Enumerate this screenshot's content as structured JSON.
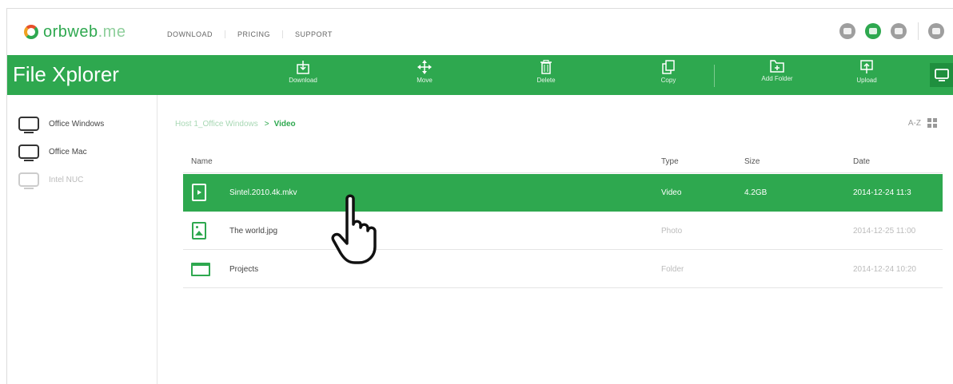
{
  "brand": {
    "name_dark": "orbweb",
    "name_light": ".me"
  },
  "nav": {
    "links": [
      "DOWNLOAD",
      "PRICING",
      "SUPPORT"
    ]
  },
  "nav_icons": [
    "chat-icon",
    "folder-icon",
    "settings-icon",
    "user-icon"
  ],
  "toolbar": {
    "title": "File Xplorer",
    "actions": [
      {
        "label": "Download",
        "icon": "download-icon"
      },
      {
        "label": "Move",
        "icon": "move-icon"
      },
      {
        "label": "Delete",
        "icon": "trash-icon"
      },
      {
        "label": "Copy",
        "icon": "copy-icon"
      },
      {
        "label": "Add Folder",
        "icon": "add-folder-icon"
      },
      {
        "label": "Upload",
        "icon": "upload-icon"
      }
    ]
  },
  "sidebar": {
    "devices": [
      {
        "name": "Office Windows",
        "active": true
      },
      {
        "name": "Office Mac",
        "active": true
      },
      {
        "name": "Intel NUC",
        "active": false
      }
    ]
  },
  "breadcrumb": {
    "host": "Host 1_Office Windows",
    "separator": ">",
    "current": "Video"
  },
  "sort": {
    "label": "A-Z"
  },
  "table": {
    "headers": {
      "name": "Name",
      "type": "Type",
      "size": "Size",
      "date": "Date"
    },
    "rows": [
      {
        "name": "Sintel.2010.4k.mkv",
        "type": "Video",
        "size": "4.2GB",
        "date": "2014-12-24 11:3",
        "selected": true,
        "icon": "video-file-icon"
      },
      {
        "name": "The world.jpg",
        "type": "Photo",
        "size": "",
        "date": "2014-12-25 11:00",
        "selected": false,
        "icon": "photo-file-icon"
      },
      {
        "name": "Projects",
        "type": "Folder",
        "size": "",
        "date": "2014-12-24 10:20",
        "selected": false,
        "icon": "folder-icon"
      }
    ]
  },
  "colors": {
    "accent": "#2ea84f",
    "accent_dark": "#1f8f3e"
  }
}
